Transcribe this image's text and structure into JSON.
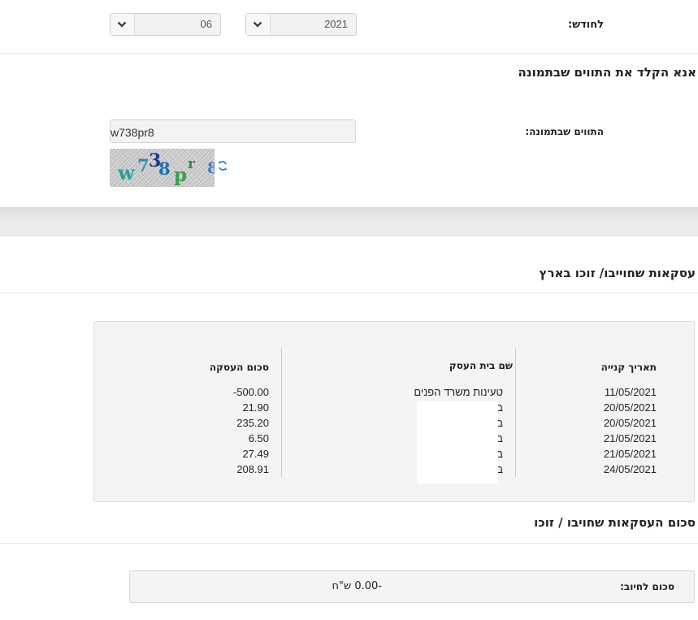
{
  "filters": {
    "month_label": "לחודש:",
    "month_value": "06",
    "year_value": "2021"
  },
  "captcha": {
    "section_title": "אנא הקלד את התווים שבתמונה",
    "field_label": "התווים שבתמונה:",
    "input_value": "w738pr8",
    "image_chars": [
      "w",
      "7",
      "3",
      "8",
      "p",
      "r",
      "8"
    ]
  },
  "transactions": {
    "section_title": "עסקאות שחוייבו/ זוכו בארץ",
    "headers": {
      "date": "תאריך קנייה",
      "merchant": "שם בית העסק",
      "amount": "סכום העסקה"
    },
    "rows": [
      {
        "date": "11/05/2021",
        "merchant": "טעינות משרד הפנים",
        "amount": "-500.00"
      },
      {
        "date": "20/05/2021",
        "merchant": "ב",
        "amount": "21.90"
      },
      {
        "date": "20/05/2021",
        "merchant": "ב",
        "amount": "235.20"
      },
      {
        "date": "21/05/2021",
        "merchant": "ב",
        "amount": "6.50"
      },
      {
        "date": "21/05/2021",
        "merchant": "ב",
        "amount": "27.49"
      },
      {
        "date": "24/05/2021",
        "merchant": "ב",
        "amount": "208.91"
      }
    ]
  },
  "summary": {
    "section_title": "סכום העסקאות שחויבו / זוכו",
    "total_label": "סכום לחיוב:",
    "total_value": "-0.00 ש\"ח"
  },
  "colors": {
    "captcha_chars": [
      "#2aa198",
      "#2b8fa8",
      "#1a3a8a",
      "#1f6fb0",
      "#3aa04a",
      "#2e8b3e",
      "#4a7ab5"
    ]
  }
}
